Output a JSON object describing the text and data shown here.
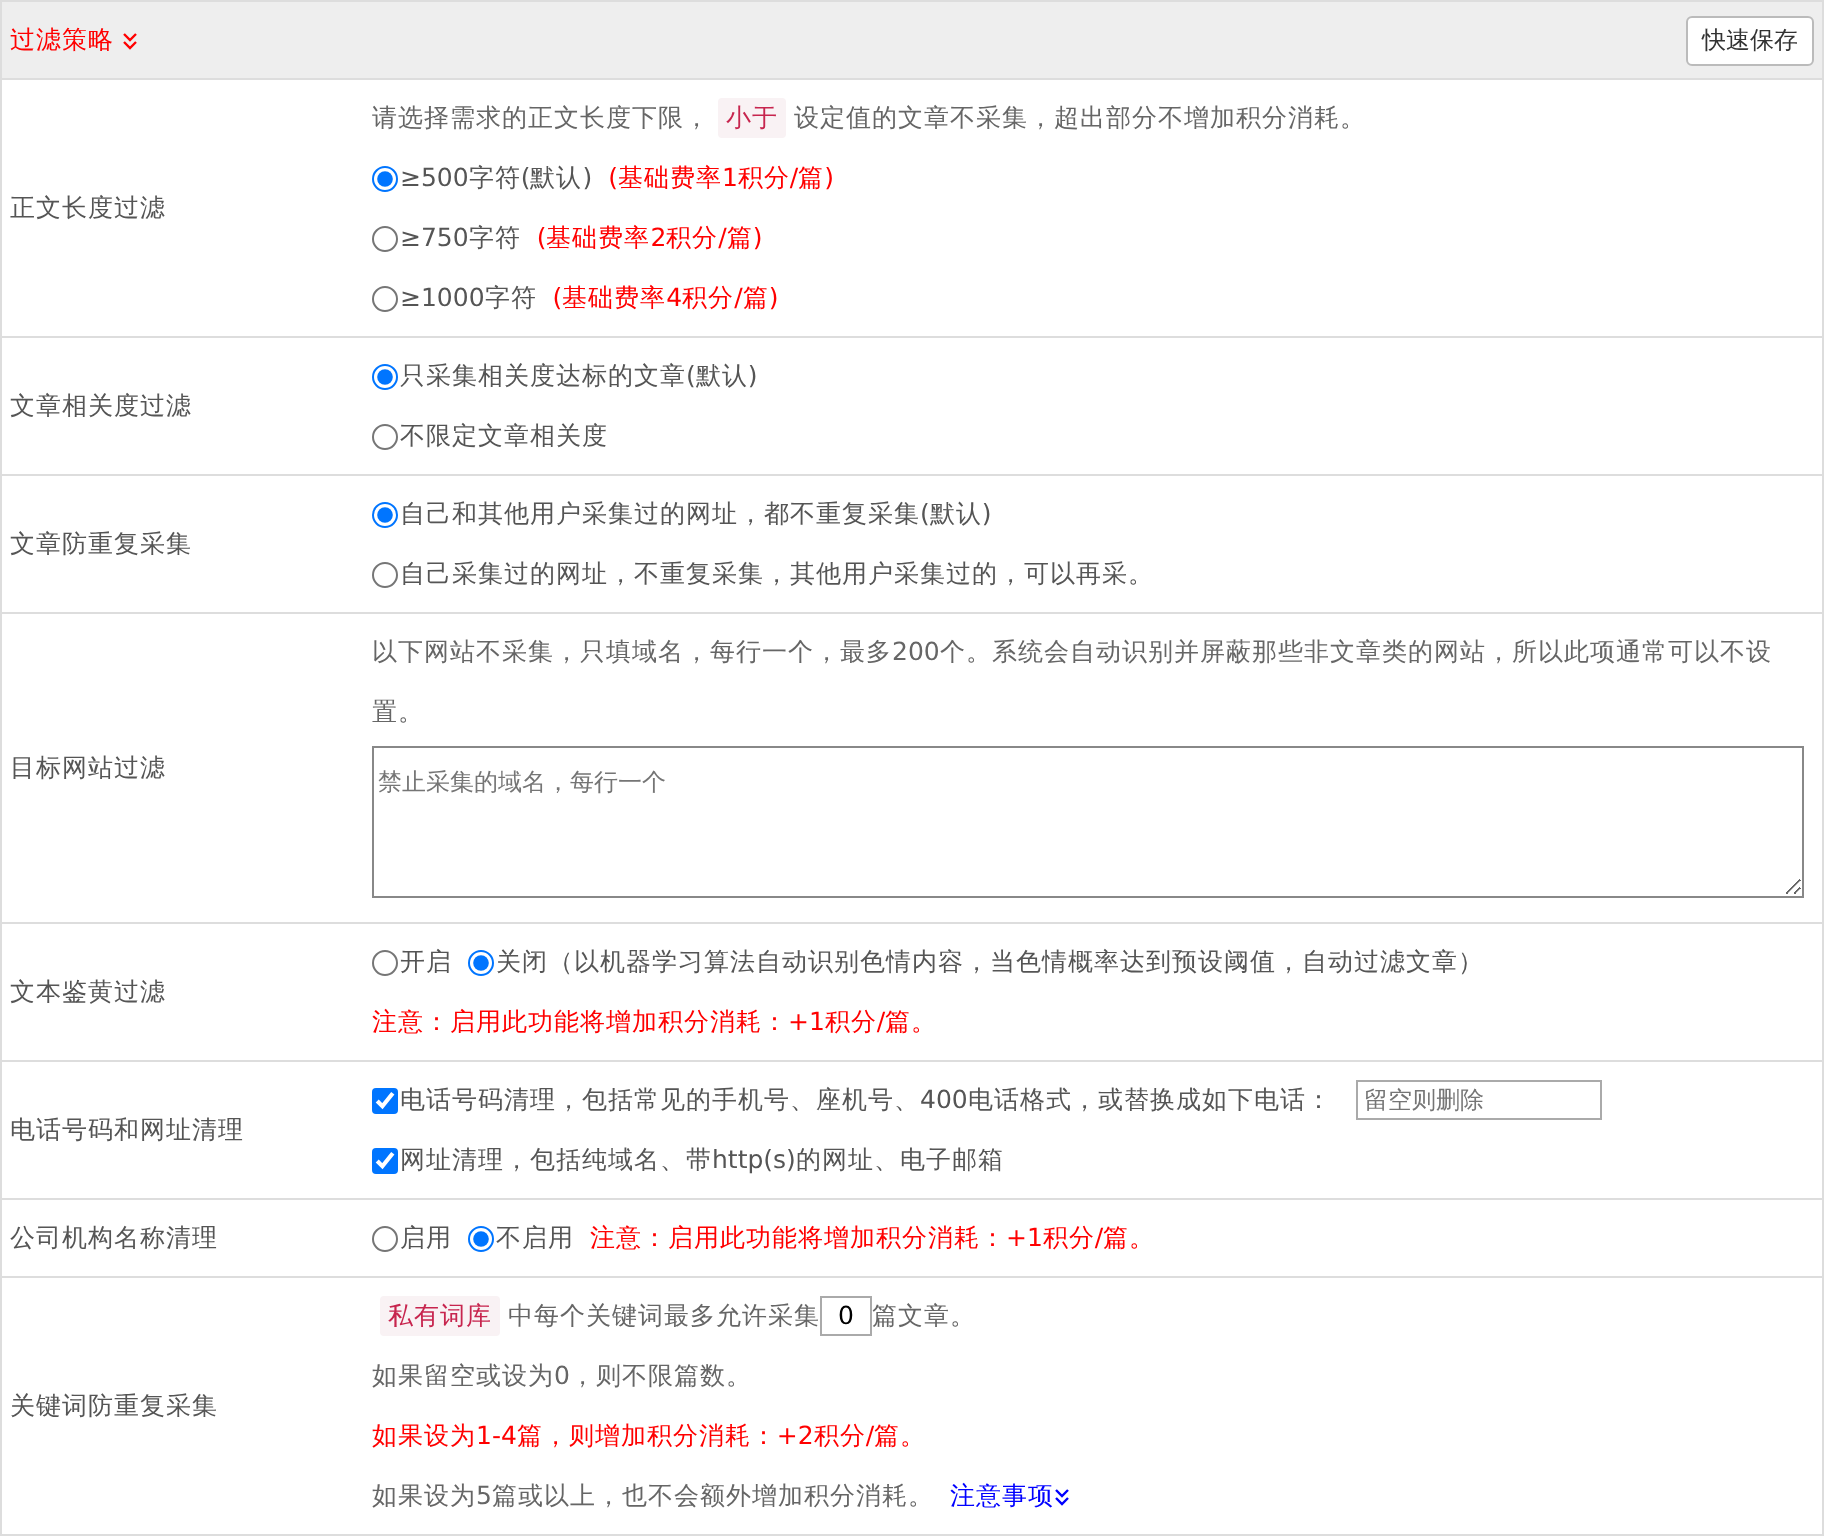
{
  "header": {
    "title": "过滤策略",
    "save_button": "快速保存"
  },
  "rows": [
    {
      "label": "正文长度过滤",
      "lines": [
        [
          {
            "kind": "text",
            "text": "请选择需求的正文长度下限，"
          },
          {
            "kind": "tag",
            "text": "小于"
          },
          {
            "kind": "text",
            "text": "设定值的文章不采集，超出部分不增加积分消耗。"
          }
        ],
        [
          {
            "kind": "radio",
            "text": "≥500字符(默认)",
            "selected": true
          },
          {
            "kind": "warn",
            "text": "(基础费率1积分/篇)"
          }
        ],
        [
          {
            "kind": "radio",
            "text": "≥750字符",
            "selected": false
          },
          {
            "kind": "warn",
            "text": "(基础费率2积分/篇)"
          }
        ],
        [
          {
            "kind": "radio",
            "text": "≥1000字符",
            "selected": false
          },
          {
            "kind": "warn",
            "text": "(基础费率4积分/篇)"
          }
        ]
      ]
    },
    {
      "label": "文章相关度过滤",
      "lines": [
        [
          {
            "kind": "radio",
            "text": "只采集相关度达标的文章(默认)",
            "selected": true
          }
        ],
        [
          {
            "kind": "radio",
            "text": "不限定文章相关度",
            "selected": false
          }
        ]
      ]
    },
    {
      "label": "文章防重复采集",
      "lines": [
        [
          {
            "kind": "radio",
            "text": "自己和其他用户采集过的网址，都不重复采集(默认)",
            "selected": true
          }
        ],
        [
          {
            "kind": "radio",
            "text": "自己采集过的网址，不重复采集，其他用户采集过的，可以再采。",
            "selected": false
          }
        ]
      ]
    },
    {
      "label": "目标网站过滤",
      "lines": [
        [
          {
            "kind": "text",
            "text": "以下网站不采集，只填域名，每行一个，最多200个。系统会自动识别并屏蔽那些非文章类的网站，所以此项通常可以不设置。"
          }
        ],
        [
          {
            "kind": "textarea",
            "placeholder": "禁止采集的域名，每行一个"
          }
        ]
      ]
    },
    {
      "label": "文本鉴黄过滤",
      "lines": [
        [
          {
            "kind": "radio",
            "text": "开启",
            "selected": false
          },
          {
            "kind": "radio",
            "text": "关闭（以机器学习算法自动识别色情内容，当色情概率达到预设阈值，自动过滤文章）",
            "selected": true
          }
        ],
        [
          {
            "kind": "warn",
            "text": "注意：启用此功能将增加积分消耗：+1积分/篇。"
          }
        ]
      ]
    },
    {
      "label": "电话号码和网址清理",
      "lines": [
        [
          {
            "kind": "checkbox",
            "text": "电话号码清理，包括常见的手机号、座机号、400电话格式，或替换成如下电话：",
            "checked": true
          },
          {
            "kind": "input",
            "placeholder": "留空则删除"
          }
        ],
        [
          {
            "kind": "checkbox",
            "text": "网址清理，包括纯域名、带http(s)的网址、电子邮箱",
            "checked": true
          }
        ]
      ]
    },
    {
      "label": "公司机构名称清理",
      "lines": [
        [
          {
            "kind": "radio",
            "text": "启用",
            "selected": false
          },
          {
            "kind": "radio",
            "text": "不启用",
            "selected": true
          },
          {
            "kind": "warn",
            "text": "注意：启用此功能将增加积分消耗：+1积分/篇。"
          }
        ]
      ]
    },
    {
      "label": "关键词防重复采集",
      "lines": [
        [
          {
            "kind": "tag",
            "text": "私有词库"
          },
          {
            "kind": "text",
            "text": "中每个关键词最多允许采集"
          },
          {
            "kind": "number",
            "value": "0"
          },
          {
            "kind": "text",
            "text": "篇文章。"
          }
        ],
        [
          {
            "kind": "text",
            "text": "如果留空或设为0，则不限篇数。"
          }
        ],
        [
          {
            "kind": "warn",
            "text": "如果设为1-4篇，则增加积分消耗：+2积分/篇。"
          }
        ],
        [
          {
            "kind": "text",
            "text": "如果设为5篇或以上，也不会额外增加积分消耗。"
          },
          {
            "kind": "link",
            "text": "注意事项"
          }
        ]
      ]
    }
  ]
}
